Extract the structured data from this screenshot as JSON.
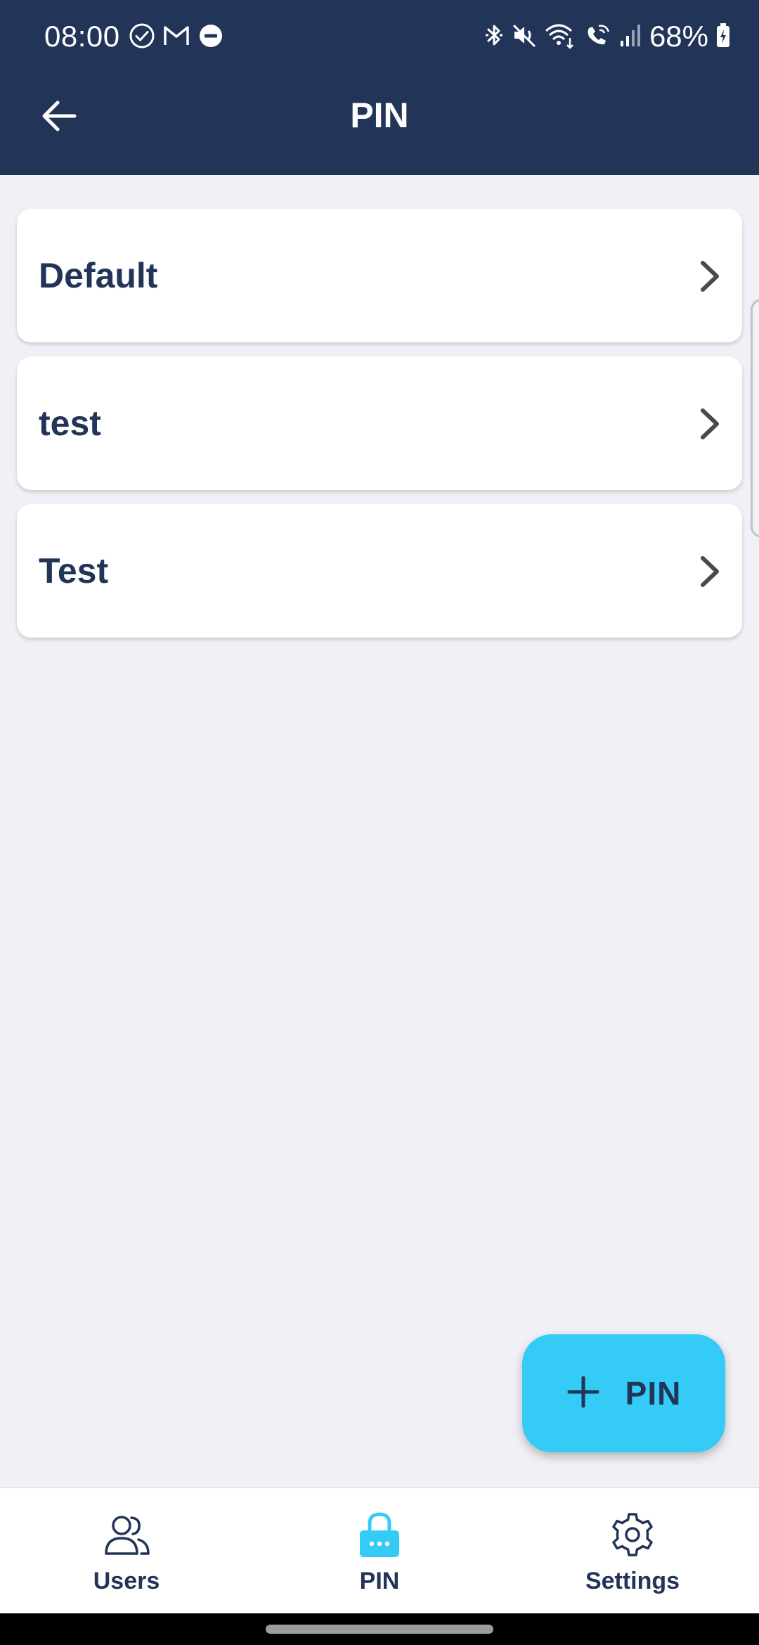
{
  "status_bar": {
    "time": "08:00",
    "battery": "68%",
    "left_icons": [
      "check-circle-icon",
      "gmail-icon",
      "do-not-disturb-icon"
    ],
    "right_icons": [
      "bluetooth-icon",
      "mute-icon",
      "wifi-icon",
      "wifi-calling-icon",
      "signal-icon",
      "battery-charging-icon"
    ]
  },
  "app_bar": {
    "title": "PIN",
    "back_icon": "arrow-left-icon"
  },
  "pin_list": {
    "items": [
      {
        "label": "Default"
      },
      {
        "label": "test"
      },
      {
        "label": "Test"
      }
    ]
  },
  "fab": {
    "icon": "plus-icon",
    "label": "PIN"
  },
  "bottom_nav": {
    "items": [
      {
        "label": "Users",
        "icon": "users-icon",
        "active": false
      },
      {
        "label": "PIN",
        "icon": "lock-icon",
        "active": true
      },
      {
        "label": "Settings",
        "icon": "gear-icon",
        "active": false
      }
    ]
  },
  "colors": {
    "header_bg": "#223457",
    "page_bg": "#f0f0f6",
    "accent": "#34ccf7",
    "text_primary": "#223457",
    "chevron": "#4a4a4a"
  }
}
